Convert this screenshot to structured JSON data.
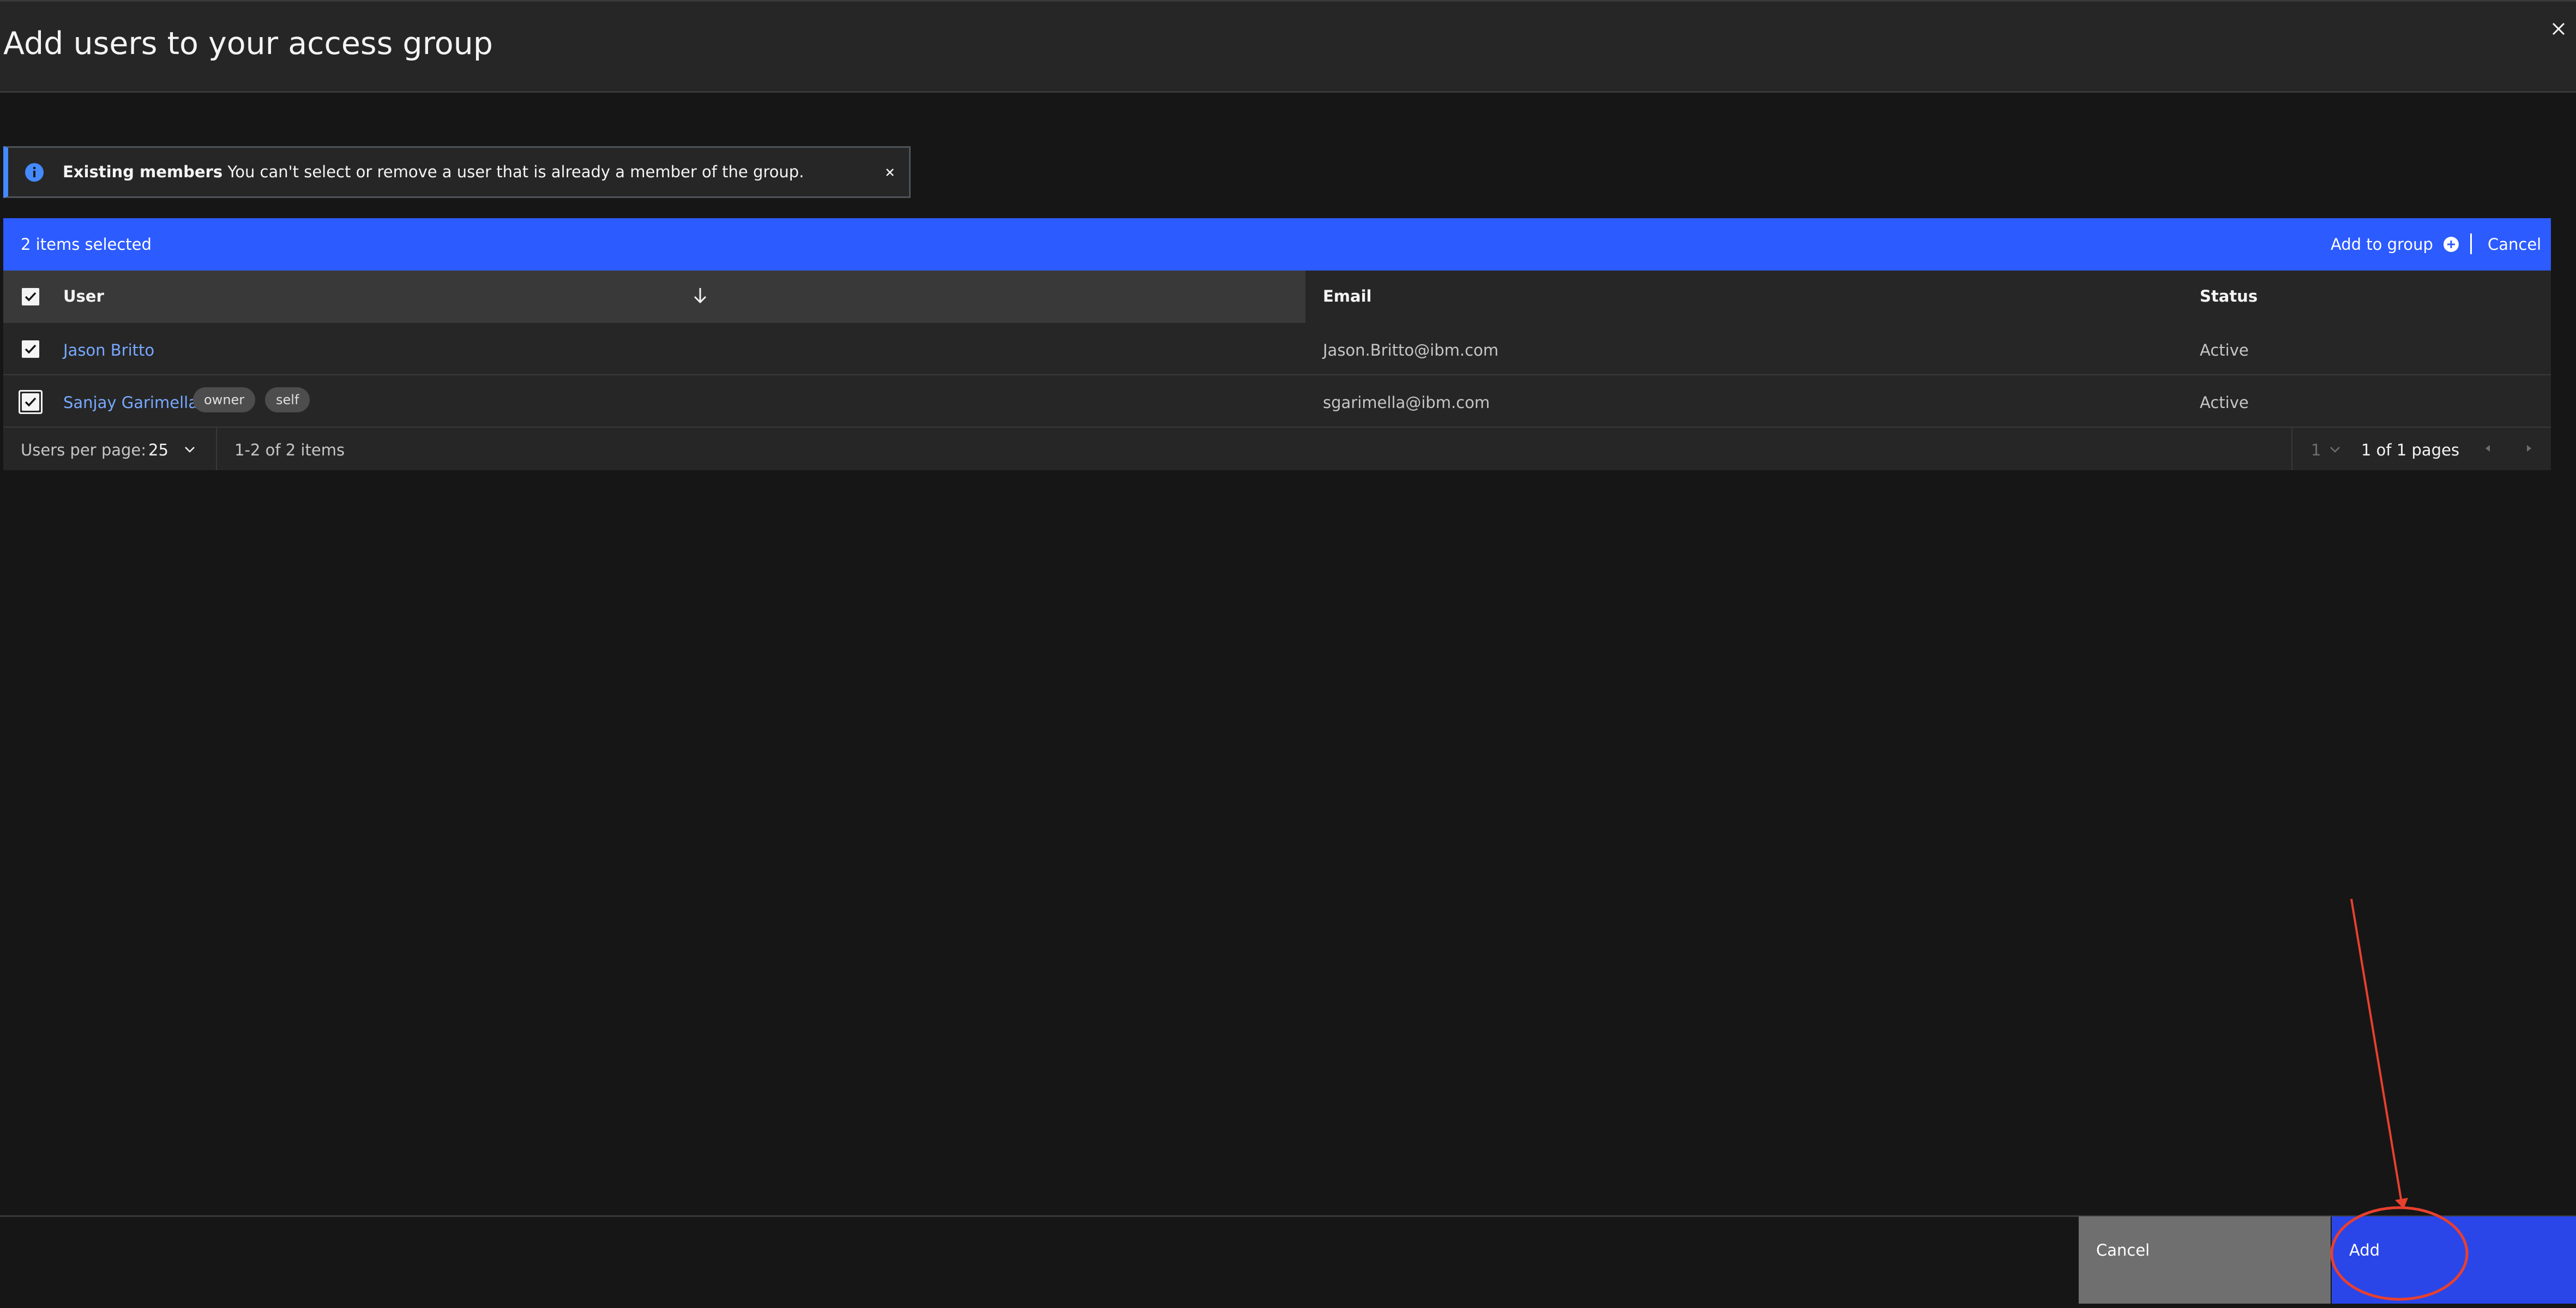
{
  "modal": {
    "title": "Add users to your access group"
  },
  "notification": {
    "title": "Existing members",
    "message": "You can't select or remove a user that is already a member of the group."
  },
  "batch_actions": {
    "selected_count": "2 items selected",
    "add_to_group": "Add to group",
    "cancel": "Cancel"
  },
  "table": {
    "headers": {
      "user": "User",
      "email": "Email",
      "status": "Status"
    },
    "rows": [
      {
        "user": "Jason Britto",
        "tags": [],
        "email": "Jason.Britto@ibm.com",
        "status": "Active"
      },
      {
        "user": "Sanjay Garimella",
        "tags": [
          "owner",
          "self"
        ],
        "email": "sgarimella@ibm.com",
        "status": "Active"
      }
    ]
  },
  "pagination": {
    "per_page_label": "Users per page:",
    "per_page_value": "25",
    "range": "1-2 of 2 items",
    "page": "1",
    "pages": "1 of 1 pages"
  },
  "footer": {
    "cancel": "Cancel",
    "add": "Add"
  },
  "colors": {
    "accent": "#2c5bff",
    "primary_button": "#2a46e8",
    "secondary_button": "#6f6f6f",
    "link": "#78a9ff",
    "annotation": "#e8402e"
  }
}
